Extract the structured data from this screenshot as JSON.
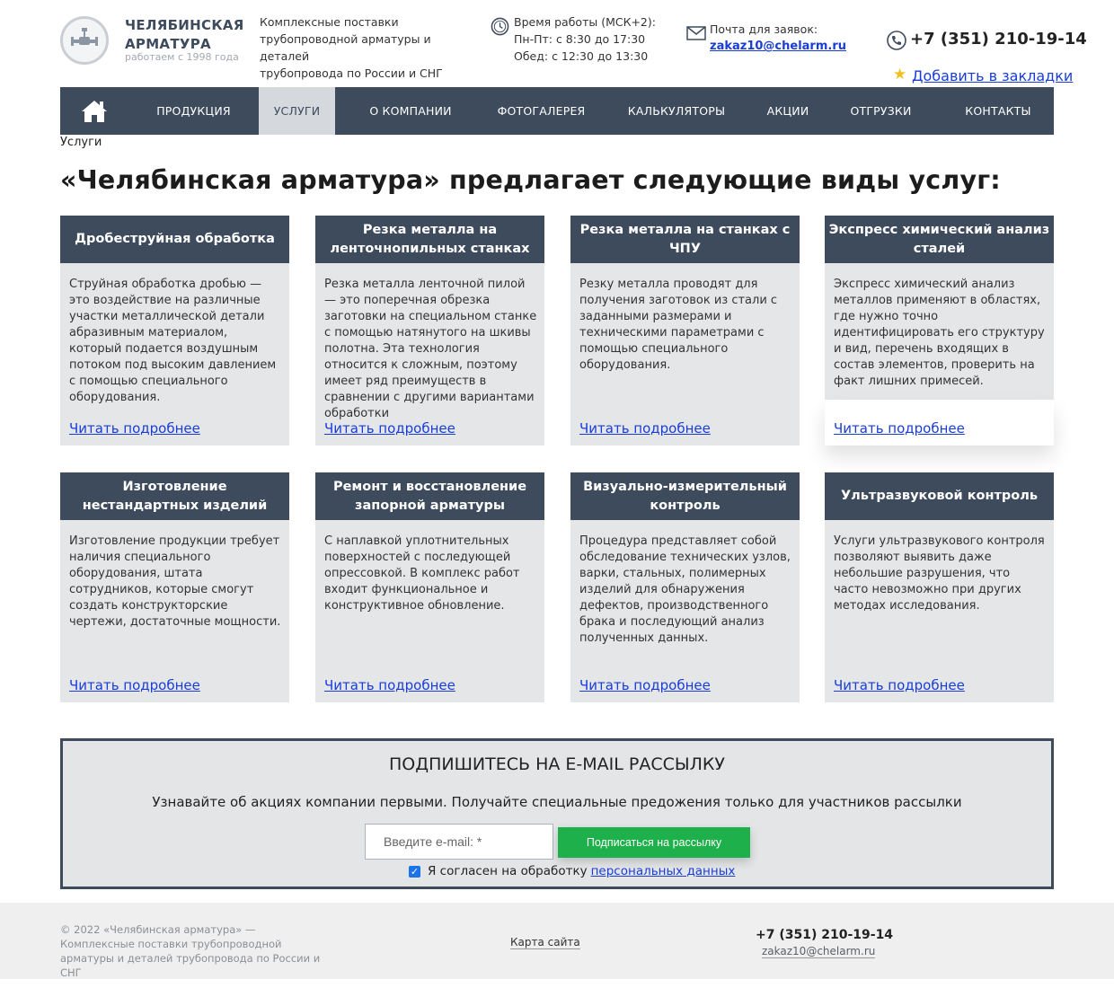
{
  "header": {
    "logo_name_line1": "ЧЕЛЯБИНСКАЯ",
    "logo_name_line2": "АРМАТУРА",
    "logo_sub": "работаем с 1998 года",
    "tagline": [
      "Комплексные поставки",
      "трубопроводной арматуры и деталей",
      "трубопровода по России и СНГ"
    ],
    "hours": [
      "Время работы (МСК+2):",
      "Пн-Пт: с 8:30 до 17:30",
      "Обед: с 12:30 до 13:30"
    ],
    "mail_label": "Почта для заявок:",
    "mail": "zakaz10@chelarm.ru",
    "phone": "+7 (351) 210-19-14",
    "bookmark": "Добавить в закладки"
  },
  "nav": {
    "items": [
      "ПРОДУКЦИЯ",
      "УСЛУГИ",
      "О КОМПАНИИ",
      "ФОТОГАЛЕРЕЯ",
      "КАЛЬКУЛЯТОРЫ",
      "АКЦИИ",
      "ОТГРУЗКИ",
      "КОНТАКТЫ"
    ],
    "active": "УСЛУГИ"
  },
  "breadcrumb": "Услуги",
  "title": "«Челябинская арматура» предлагает следующие виды услуг:",
  "cards": [
    {
      "title": "Дробеструйная обработка",
      "text": "Струйная обработка дробью — это воздействие на различные участки металлической детали абразивным материалом, который подается воздушным потоком под высоким давлением с помощью специального оборудования.",
      "link": "Читать подробнее"
    },
    {
      "title": "Резка металла на ленточнопильных станках",
      "text": "Резка металла ленточной пилой — это поперечная обрезка заготовки на специальном станке с помощью натянутого на шкивы полотна. Эта технология относится к сложным, поэтому имеет ряд преимуществ в сравнении с другими вариантами обработки",
      "link": "Читать подробнее"
    },
    {
      "title": "Резка металла на станках с ЧПУ",
      "text": "Резку металла проводят для получения заготовок из стали с заданными размерами и техническими параметрами с помощью специального оборудования.",
      "link": "Читать подробнее"
    },
    {
      "title": "Экспресс химический анализ сталей",
      "text": "Экспресс химический анализ металлов применяют в областях, где нужно точно идентифицировать его структуру и вид, перечень входящих в состав элементов, проверить на факт лишних примесей.",
      "link": "Читать подробнее"
    },
    {
      "title": "Изготовление нестандартных изделий",
      "text": "Изготовление продукции требует наличия специального оборудования, штата сотрудников, которые смогут создать конструкторские чертежи, достаточные мощности.",
      "link": "Читать подробнее"
    },
    {
      "title": "Ремонт и восстановление запорной арматуры",
      "text": "С наплавкой уплотнительных поверхностей с последующей опрессовкой. В комплекс работ входит функциональное и конструктивное обновление.",
      "link": "Читать подробнее"
    },
    {
      "title": "Визуально-измерительный контроль",
      "text": "Процедура представляет собой обследование технических узлов, варки, стальных, полимерных изделий для обнаружения дефектов, производственного брака и последующий анализ полученных данных.",
      "link": "Читать подробнее"
    },
    {
      "title": "Ультразвуковой контроль",
      "text": "Услуги ультразвукового контроля позволяют выявить даже небольшие разрушения, что часто невозможно при других методах исследования.",
      "link": "Читать подробнее"
    }
  ],
  "subscribe": {
    "title": "ПОДПИШИТЕСЬ НА E-MAIL РАССЫЛКУ",
    "text": "Узнавайте об акциях компании первыми. Получайте специальные предожения только для участников рассылки",
    "placeholder": "Введите e-mail: *",
    "button": "Подписаться на рассылку",
    "agree_text": "Я согласен на обработку",
    "agree_link": "персональных данных",
    "agree_checked": true
  },
  "footer": {
    "copyright": "© 2022 «Челябинская арматура» — Комплексные поставки трубопроводной арматуры и деталей трубопровода по России и СНГ",
    "sitemap": "Карта сайта",
    "phone": "+7 (351) 210-19-14",
    "mail": "zakaz10@chelarm.ru"
  },
  "colors": {
    "nav_bg": "#3d4b5d",
    "card_bg": "#e4e6e8",
    "link": "#1a3dd6",
    "button": "#1eb04a"
  }
}
